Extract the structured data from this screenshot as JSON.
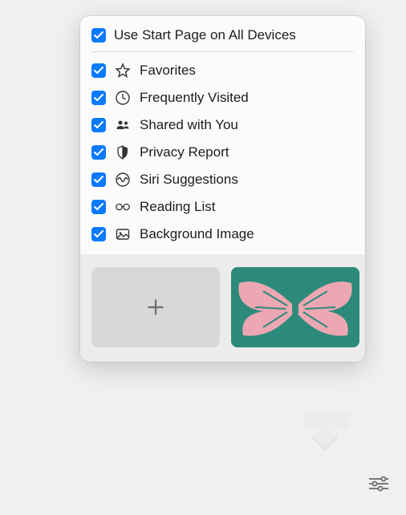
{
  "popover": {
    "useStartPageLabel": "Use Start Page on All Devices",
    "useStartPageChecked": true,
    "sections": [
      {
        "id": "favorites",
        "label": "Favorites",
        "icon": "star-icon",
        "checked": true
      },
      {
        "id": "frequently",
        "label": "Frequently Visited",
        "icon": "clock-icon",
        "checked": true
      },
      {
        "id": "shared",
        "label": "Shared with You",
        "icon": "people-icon",
        "checked": true
      },
      {
        "id": "privacy",
        "label": "Privacy Report",
        "icon": "shield-icon",
        "checked": true
      },
      {
        "id": "siri",
        "label": "Siri Suggestions",
        "icon": "siri-icon",
        "checked": true
      },
      {
        "id": "reading",
        "label": "Reading List",
        "icon": "glasses-icon",
        "checked": true
      },
      {
        "id": "background",
        "label": "Background Image",
        "icon": "image-icon",
        "checked": true
      }
    ],
    "thumbnails": {
      "addLabel": "Add Background",
      "selectedImage": "butterfly-wallpaper"
    }
  },
  "customizeButton": {
    "name": "customize-start-page"
  },
  "colors": {
    "checkboxBlue": "#0a7aff"
  }
}
